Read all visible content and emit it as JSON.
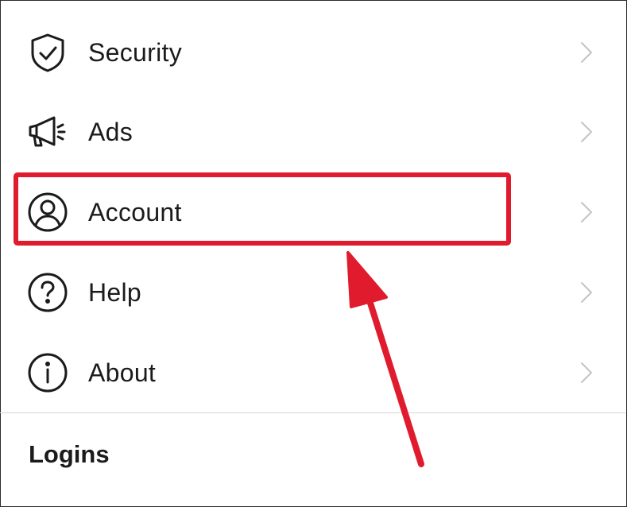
{
  "menu": {
    "items": [
      {
        "label": "Security",
        "icon": "shield-check-icon"
      },
      {
        "label": "Ads",
        "icon": "megaphone-icon"
      },
      {
        "label": "Account",
        "icon": "user-circle-icon"
      },
      {
        "label": "Help",
        "icon": "question-circle-icon"
      },
      {
        "label": "About",
        "icon": "info-circle-icon"
      }
    ],
    "chevron_icon": "chevron-right-icon"
  },
  "section": {
    "title": "Logins"
  },
  "annotation": {
    "highlighted_item": "Account",
    "color": "#e01b2e"
  }
}
